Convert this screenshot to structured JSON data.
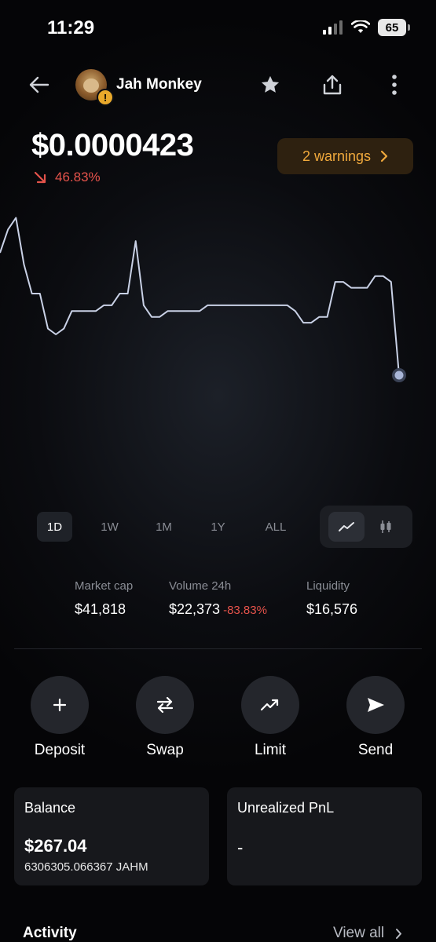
{
  "status_bar": {
    "time": "11:29",
    "battery": "65"
  },
  "header": {
    "token_name": "Jah Monkey",
    "warning_badge": "!"
  },
  "price": {
    "value": "$0.0000423",
    "change": "46.83%",
    "change_direction": "down"
  },
  "warnings_button": {
    "label": "2 warnings"
  },
  "chart_data": {
    "type": "line",
    "x": [
      0,
      1,
      2,
      3,
      4,
      5,
      6,
      7,
      8,
      9,
      10,
      11,
      12,
      13,
      14,
      15,
      16,
      17,
      18,
      19,
      20,
      21,
      22,
      23,
      24,
      25,
      26,
      27,
      28,
      29,
      30,
      31,
      32,
      33,
      34,
      35,
      36,
      37,
      38,
      39,
      40,
      41,
      42,
      43,
      44,
      45,
      46,
      47,
      48,
      49,
      50
    ],
    "values": [
      78,
      82,
      84,
      76,
      71,
      71,
      65,
      64,
      65,
      68,
      68,
      68,
      68,
      69,
      69,
      71,
      71,
      80,
      69,
      67,
      67,
      68,
      68,
      68,
      68,
      68,
      69,
      69,
      69,
      69,
      69,
      69,
      69,
      69,
      69,
      69,
      69,
      68,
      66,
      66,
      67,
      67,
      73,
      73,
      72,
      72,
      72,
      74,
      74,
      73,
      57
    ],
    "current_value": "$0.0000423",
    "colors": {
      "line": "#c9d1e6",
      "marker": "#a9b6d8"
    }
  },
  "time_ranges": [
    {
      "label": "1D",
      "active": true
    },
    {
      "label": "1W",
      "active": false
    },
    {
      "label": "1M",
      "active": false
    },
    {
      "label": "1Y",
      "active": false
    },
    {
      "label": "ALL",
      "active": false
    }
  ],
  "chart_toggle": {
    "options": [
      "line-chart-icon",
      "candlestick-icon"
    ],
    "active": "line-chart-icon"
  },
  "stats": {
    "market_cap": {
      "label": "Market cap",
      "value": "$41,818"
    },
    "volume": {
      "label": "Volume 24h",
      "value": "$22,373",
      "delta": "-83.83%"
    },
    "liquidity": {
      "label": "Liquidity",
      "value": "$16,576"
    }
  },
  "actions": [
    {
      "label": "Deposit",
      "icon": "plus-icon"
    },
    {
      "label": "Swap",
      "icon": "swap-arrows-icon"
    },
    {
      "label": "Limit",
      "icon": "trend-up-icon"
    },
    {
      "label": "Send",
      "icon": "send-icon"
    }
  ],
  "balance_card": {
    "title": "Balance",
    "value": "$267.04",
    "amount": "6306305.066367 JAHM"
  },
  "pnl_card": {
    "title": "Unrealized PnL",
    "value": "-"
  },
  "activity": {
    "title": "Activity",
    "view_all": "View all"
  },
  "colors": {
    "negative": "#e5534b",
    "warning": "#f0a93c",
    "warning_bg": "#2e2110"
  }
}
